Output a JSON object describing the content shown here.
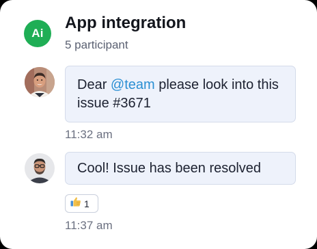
{
  "chat": {
    "avatar_initials": "Ai",
    "title": "App integration",
    "participants": "5 participant"
  },
  "messages": [
    {
      "text_before": "Dear ",
      "mention": "@team",
      "text_after": " please look into this issue #3671",
      "time": "11:32 am"
    },
    {
      "text": "Cool! Issue has been resolved",
      "reaction": {
        "icon": "thumbs-up-icon",
        "count": "1"
      },
      "time": "11:37 am"
    }
  ],
  "colors": {
    "accent_green": "#1fae55",
    "mention_blue": "#2a8fd3",
    "bubble_bg": "#eef2fb"
  }
}
